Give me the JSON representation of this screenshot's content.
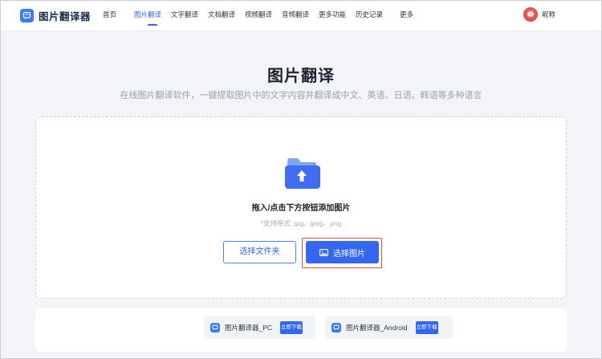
{
  "header": {
    "app_name": "图片翻译器",
    "nav": [
      {
        "label": "首页",
        "active": false
      },
      {
        "label": "图片翻译",
        "active": true
      },
      {
        "label": "文字翻译",
        "active": false
      },
      {
        "label": "文档翻译",
        "active": false
      },
      {
        "label": "视频翻译",
        "active": false
      },
      {
        "label": "音频翻译",
        "active": false
      },
      {
        "label": "更多功能",
        "active": false
      },
      {
        "label": "历史记录",
        "active": false
      },
      {
        "label": "更多",
        "active": false
      }
    ],
    "user": {
      "nickname": "昵称"
    }
  },
  "hero": {
    "title": "图片翻译",
    "subtitle": "在线图片翻译软件，一键提取图片中的文字内容并翻译成中文、英语、日语、韩语等多种语言"
  },
  "upload": {
    "drop_text": "拖入/点击下方按钮添加图片",
    "formats_text": "*支持格式: jpg、jpeg、png",
    "select_folder_label": "选择文件夹",
    "select_image_label": "选择图片"
  },
  "downloads": [
    {
      "name": "图片翻译器_PC",
      "button": "立即下载"
    },
    {
      "name": "图片翻译器_Android",
      "button": "立即下载"
    }
  ],
  "colors": {
    "accent": "#3566ef",
    "highlight_border": "#e04c3c",
    "background": "#f2f4f8"
  }
}
